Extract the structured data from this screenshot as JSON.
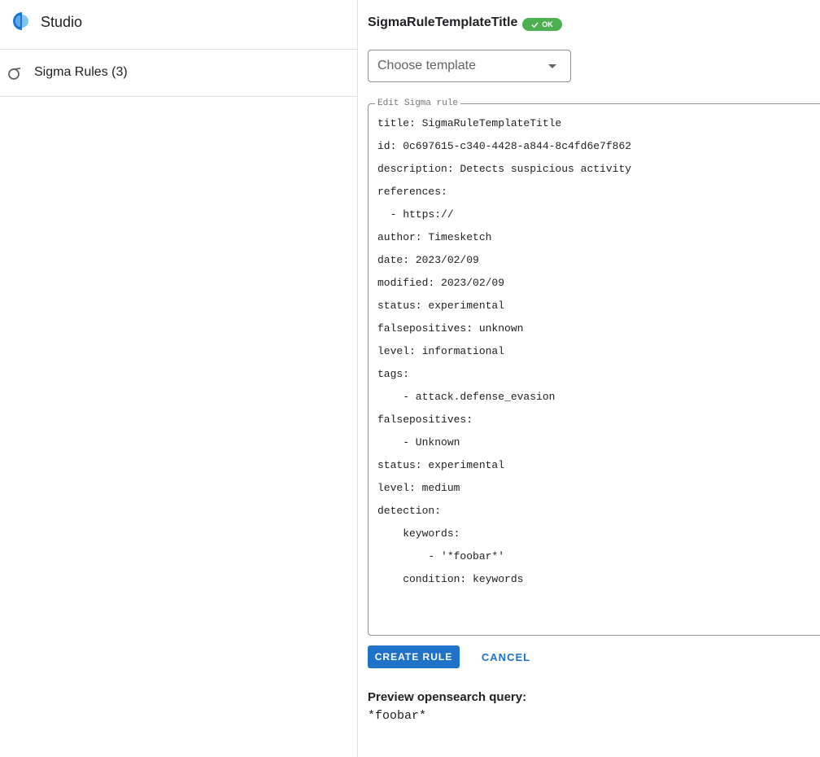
{
  "app": {
    "name": "Studio"
  },
  "sidebar": {
    "items": [
      {
        "label": "Sigma Rules (3)",
        "icon": "sigma-icon"
      }
    ]
  },
  "rule": {
    "title": "SigmaRuleTemplateTitle",
    "status_badge": "OK"
  },
  "template_select": {
    "placeholder": "Choose template"
  },
  "editor": {
    "legend": "Edit Sigma rule",
    "lines": [
      "title: SigmaRuleTemplateTitle",
      "id: 0c697615-c340-4428-a844-8c4fd6e7f862",
      "description: Detects suspicious activity",
      "references:",
      "  - https://",
      "author: Timesketch",
      "date: 2023/02/09",
      "modified: 2023/02/09",
      "status: experimental",
      "falsepositives: unknown",
      "level: informational",
      "tags:",
      "    - attack.defense_evasion",
      "falsepositives:",
      "    - Unknown",
      "status: experimental",
      "level: medium",
      "detection:",
      "    keywords:",
      "        - '*foobar*'",
      "    condition: keywords"
    ]
  },
  "actions": {
    "create": "CREATE RULE",
    "cancel": "CANCEL"
  },
  "preview": {
    "heading": "Preview opensearch query:",
    "query": "*foobar*"
  },
  "colors": {
    "accent": "#1e73c8",
    "ok": "#4caf50",
    "border": "#e0e0e0"
  }
}
